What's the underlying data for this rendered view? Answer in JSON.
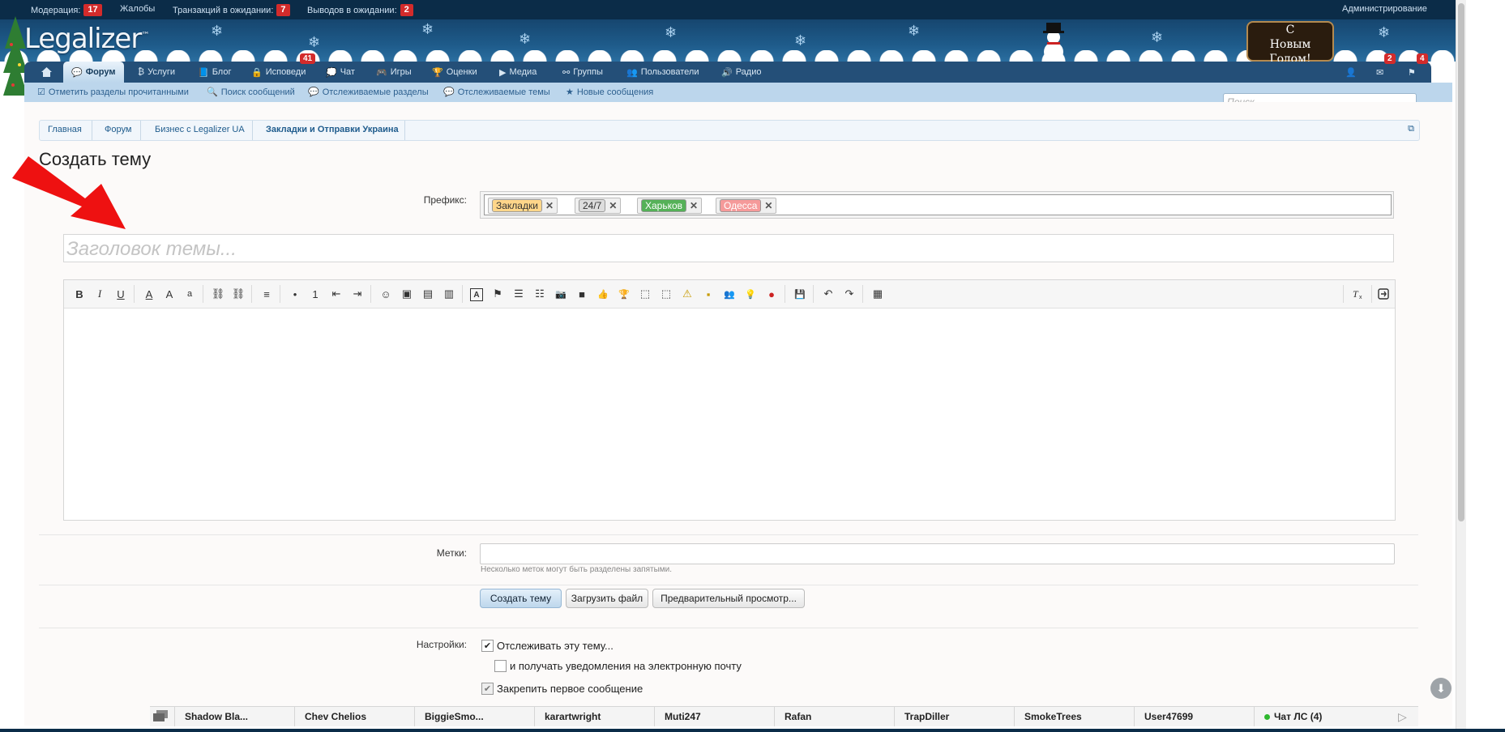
{
  "moderator_bar": {
    "items": [
      {
        "label": "Модерация:",
        "count": "17"
      },
      {
        "label": "Жалобы",
        "count": ""
      },
      {
        "label": "Транзакций в ожидании:",
        "count": "7"
      },
      {
        "label": "Выводов в ожидании:",
        "count": "2"
      }
    ],
    "admin_label": "Администрирование"
  },
  "header": {
    "logo_text": "Legalizer",
    "logo_tm": "™",
    "banner_text_line1": "С",
    "banner_text_line2": "Новым",
    "banner_text_line3": "Годом!"
  },
  "nav": {
    "tabs": [
      {
        "label": "",
        "icon": "home-icon"
      },
      {
        "label": "Форум",
        "icon": "chat-bubbles-icon"
      },
      {
        "label": "Услуги",
        "icon": "bitcoin-icon"
      },
      {
        "label": "Блог",
        "icon": "book-icon"
      },
      {
        "label": "Исповеди",
        "icon": "lock-icon",
        "badge": "41"
      },
      {
        "label": "Чат",
        "icon": "chat-icon"
      },
      {
        "label": "Игры",
        "icon": "gamepad-icon"
      },
      {
        "label": "Оценки",
        "icon": "trophy-icon"
      },
      {
        "label": "Медиа",
        "icon": "video-icon"
      },
      {
        "label": "Группы",
        "icon": "sitemap-icon"
      },
      {
        "label": "Пользователи",
        "icon": "users-icon"
      },
      {
        "label": "Радио",
        "icon": "volume-icon"
      }
    ],
    "right": [
      {
        "icon": "user-icon",
        "badge": ""
      },
      {
        "icon": "envelope-icon",
        "badge": "2"
      },
      {
        "icon": "flag-icon",
        "badge": "4"
      }
    ]
  },
  "subnav": {
    "items": [
      {
        "label": "Отметить разделы прочитанными",
        "icon": "check-square-icon"
      },
      {
        "label": "Поиск сообщений",
        "icon": "search-icon"
      },
      {
        "label": "Отслеживаемые разделы",
        "icon": "comment-icon"
      },
      {
        "label": "Отслеживаемые темы",
        "icon": "comments-icon"
      },
      {
        "label": "Новые сообщения",
        "icon": "star-icon"
      }
    ],
    "search_placeholder": "Поиск..."
  },
  "breadcrumb": [
    "Главная",
    "Форум",
    "Бизнес с Legalizer UA",
    "Закладки и Отправки Украина"
  ],
  "page_title": "Создать тему",
  "form": {
    "prefix_label": "Префикс:",
    "prefixes": [
      {
        "label": "Закладки",
        "color": "#ffd68a",
        "text_color": "#333333"
      },
      {
        "label": "24/7",
        "color": "#dddddd",
        "text_color": "#333333"
      },
      {
        "label": "Харьков",
        "color": "#55b158",
        "text_color": "#ffffff"
      },
      {
        "label": "Одесса",
        "color": "#f59a9a",
        "text_color": "#ffffff"
      }
    ],
    "title_placeholder": "Заголовок темы...",
    "tags_label": "Метки:",
    "tags_hint": "Несколько меток могут быть разделены запятыми.",
    "buttons": {
      "create": "Создать тему",
      "upload": "Загрузить файл",
      "preview": "Предварительный просмотр..."
    },
    "settings_label": "Настройки:",
    "options": [
      {
        "label": "Отслеживать эту тему...",
        "checked": true
      },
      {
        "label": "и получать уведомления на электронную почту",
        "checked": false
      },
      {
        "label": "Закрепить первое сообщение",
        "checked": true
      }
    ]
  },
  "editor_toolbar": [
    "B",
    "I",
    "U",
    "A",
    "A",
    "a",
    "⛓",
    "⛓",
    "≡",
    "•",
    "1",
    "⇤",
    "⇥",
    "☺",
    "▣",
    "▤",
    "▥",
    "A",
    "⚑",
    "☰",
    "☷",
    "📷",
    "■",
    "👍",
    "🏆",
    "⬚",
    "⬚",
    "⚠",
    "▪",
    "👥",
    "💡",
    "●",
    "💾",
    "↶",
    "↷",
    "▦"
  ],
  "chat": {
    "users": [
      "Shadow Bla...",
      "Chev Chelios",
      "BiggieSmo...",
      "karartwright",
      "Muti247",
      "Rafan",
      "TrapDiller",
      "SmokeTrees",
      "User47699"
    ],
    "chat_label": "Чат ЛС (4)"
  }
}
